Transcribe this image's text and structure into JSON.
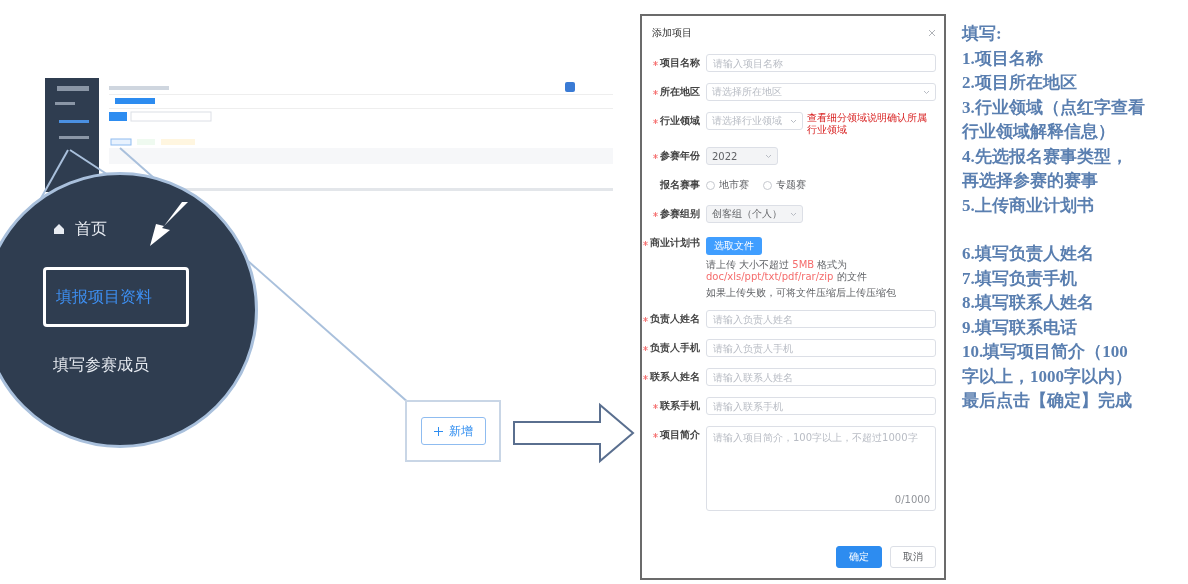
{
  "magnifier": {
    "items": [
      {
        "label": "首页",
        "kind": "home",
        "selected": false
      },
      {
        "label": "填报项目资料",
        "kind": "plain",
        "selected": true
      },
      {
        "label": "填写参赛成员",
        "kind": "plain",
        "selected": false
      }
    ]
  },
  "callout_button": {
    "label": "新增"
  },
  "dialog": {
    "title": "添加项目",
    "fields": [
      {
        "kind": "input",
        "label": "项目名称",
        "required": true,
        "placeholder": "请输入项目名称"
      },
      {
        "kind": "select",
        "label": "所在地区",
        "required": true,
        "placeholder": "请选择所在地区",
        "disabled": false,
        "wide": true
      },
      {
        "kind": "select",
        "label": "行业领域",
        "required": true,
        "placeholder": "请选择行业领域",
        "disabled": false,
        "wide": false,
        "link": "查看细分领域说明确认所属行业领域"
      },
      {
        "kind": "select",
        "label": "参赛年份",
        "required": true,
        "value": "2022",
        "disabled": true,
        "wide": false
      },
      {
        "kind": "radio",
        "label": "报名赛事",
        "required": false,
        "options": [
          {
            "label": "地市赛",
            "selected": false
          },
          {
            "label": "专题赛",
            "selected": false
          }
        ]
      },
      {
        "kind": "select",
        "label": "参赛组别",
        "required": true,
        "value": "创客组（个人）",
        "disabled": true,
        "wide": false
      },
      {
        "kind": "upload",
        "label": "商业计划书",
        "required": true,
        "button": "选取文件",
        "tip": [
          {
            "text": "请上传 大小不超过 ",
            "highlight": false
          },
          {
            "text": "5MB",
            "highlight": true
          },
          {
            "text": " 格式为 ",
            "highlight": false
          },
          {
            "text": "doc/xls/ppt/txt/pdf/rar/zip",
            "highlight": true
          },
          {
            "text": " 的文件",
            "highlight": false
          }
        ],
        "tip_2": "如果上传失败，可将文件压缩后上传压缩包"
      },
      {
        "kind": "input",
        "label": "负责人姓名",
        "required": true,
        "placeholder": "请输入负责人姓名"
      },
      {
        "kind": "input",
        "label": "负责人手机",
        "required": true,
        "placeholder": "请输入负责人手机"
      },
      {
        "kind": "input",
        "label": "联系人姓名",
        "required": true,
        "placeholder": "请输入联系人姓名"
      },
      {
        "kind": "input",
        "label": "联系手机",
        "required": true,
        "placeholder": "请输入联系手机"
      },
      {
        "kind": "textarea",
        "label": "项目简介",
        "required": true,
        "placeholder": "请输入项目简介，100字以上，不超过1000字",
        "counter": "0/1000"
      }
    ],
    "buttons": [
      {
        "label": "确定",
        "primary": true
      },
      {
        "label": "取消",
        "primary": false
      }
    ]
  },
  "instructions": [
    {
      "lines": [
        "填写:",
        "1.项目名称",
        "2.项目所在地区",
        "3.行业领域（点红字查看",
        "行业领域解释信息）",
        "4.先选报名赛事类型，",
        "再选择参赛的赛事",
        "5.上传商业计划书"
      ]
    },
    {
      "lines": [
        "6.填写负责人姓名",
        "7.填写负责手机",
        "8.填写联系人姓名",
        "9.填写联系电话",
        "10.填写项目简介（100",
        "字以上，1000字以内）",
        "最后点击【确定】完成"
      ]
    }
  ]
}
